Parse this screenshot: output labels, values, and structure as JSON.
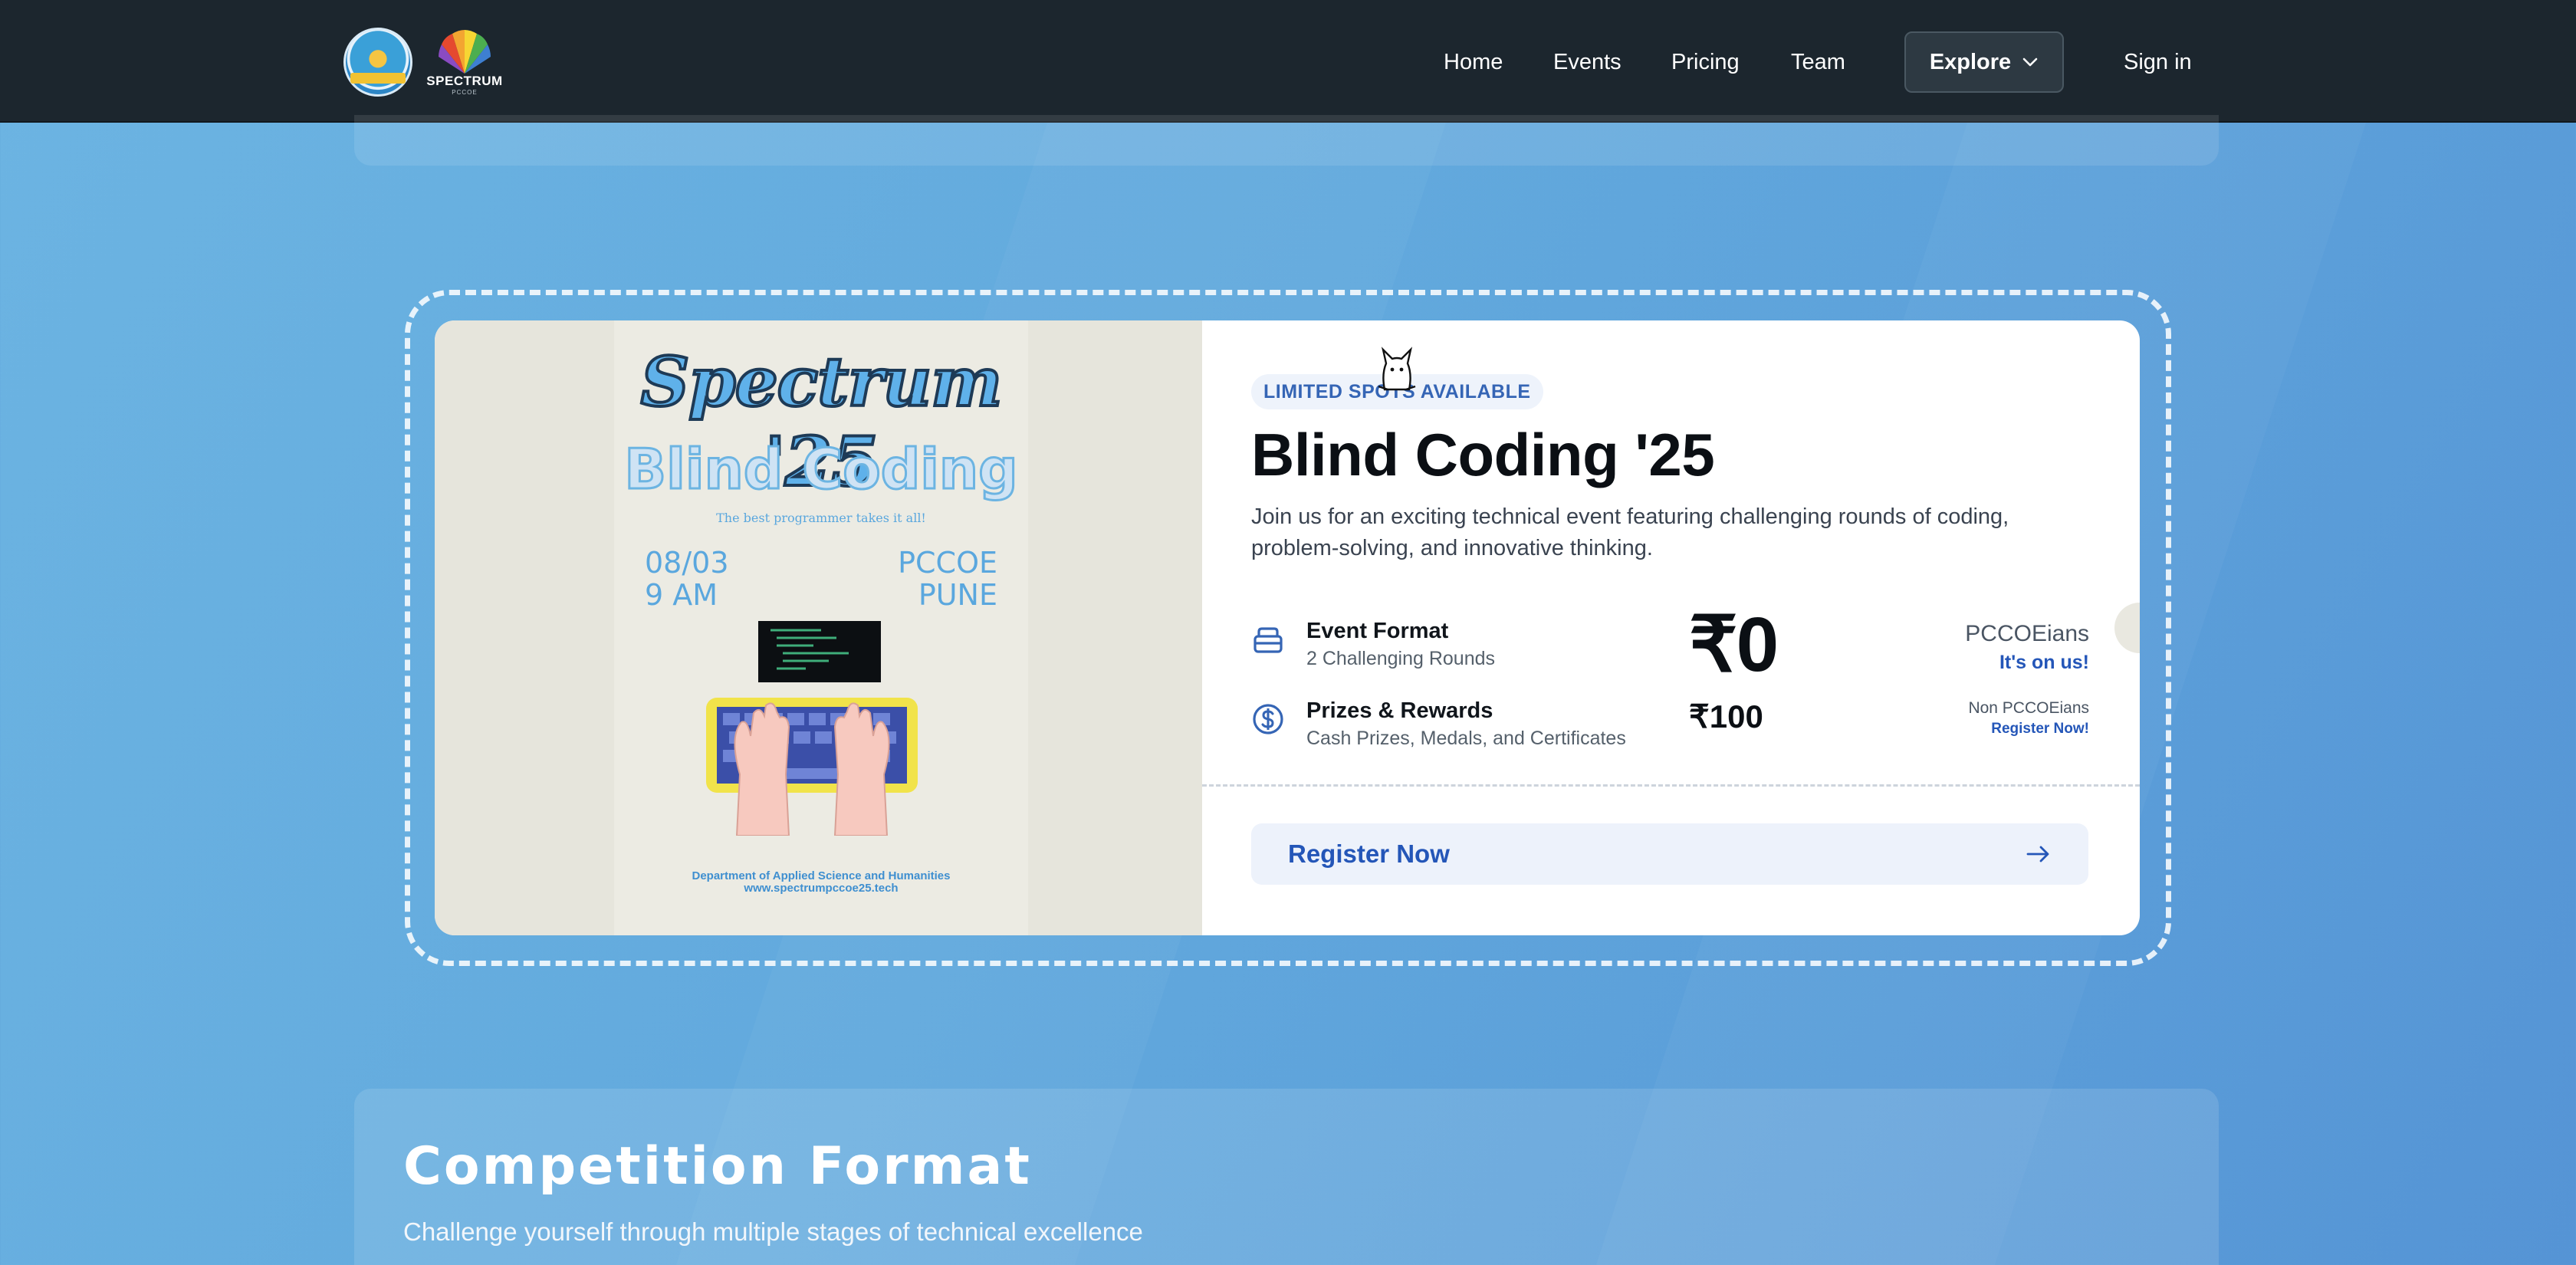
{
  "navbar": {
    "logo_text": "SPECTRUM",
    "logo_subtext": "PCCOE",
    "links": {
      "home": "Home",
      "events": "Events",
      "pricing": "Pricing",
      "team": "Team",
      "explore": "Explore",
      "sign_in": "Sign in"
    }
  },
  "poster": {
    "title": "Spectrum '25",
    "subtitle": "Blind Coding",
    "tagline": "The best programmer takes it all!",
    "date": "08/03",
    "time": "9 AM",
    "venue_line1": "PCCOE",
    "venue_line2": "PUNE",
    "department": "Department of Applied Science and Humanities",
    "url": "www.spectrumpccoe25.tech"
  },
  "event": {
    "badge": "LIMITED SPOTS AVAILABLE",
    "title": "Blind Coding '25",
    "description": "Join us for an exciting technical event featuring challenging rounds of coding, problem-solving, and innovative thinking.",
    "features": [
      {
        "title": "Event Format",
        "subtitle": "2 Challenging Rounds",
        "icon": "stack-icon"
      },
      {
        "title": "Prizes & Rewards",
        "subtitle": "Cash Prizes, Medals, and Certificates",
        "icon": "dollar-circle-icon"
      }
    ],
    "pricing": {
      "main_price": "₹0",
      "main_audience": "PCCOEians",
      "main_note": "It's on us!",
      "alt_price": "₹100",
      "alt_audience": "Non PCCOEians",
      "alt_note": "Register Now!"
    },
    "register_label": "Register Now"
  },
  "format_section": {
    "title": "Competition Format",
    "subtitle": "Challenge yourself through multiple stages of technical excellence"
  },
  "colors": {
    "navbar_bg": "#1c262e",
    "page_bg": "#62a9dd",
    "accent_blue": "#2456b8",
    "badge_bg": "#eef3fb"
  }
}
